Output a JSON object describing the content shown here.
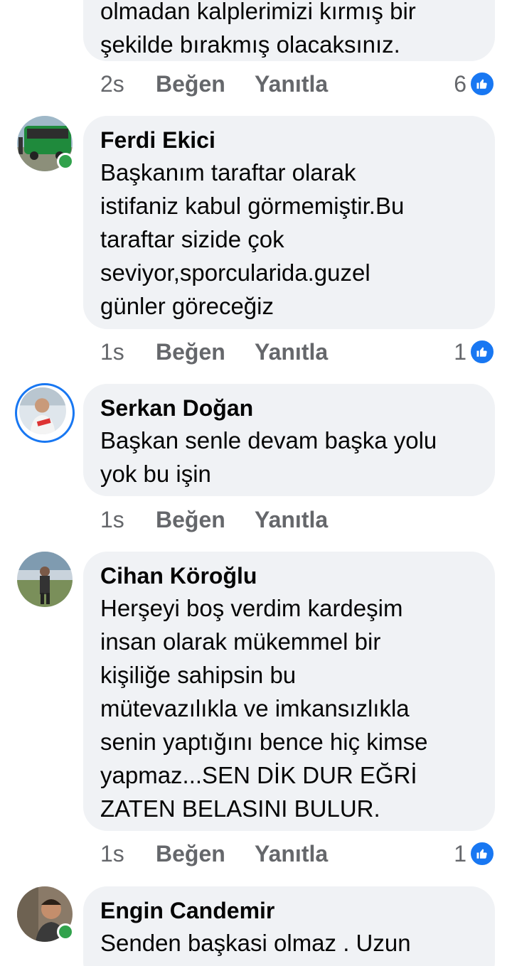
{
  "comments": [
    {
      "author": "",
      "text": "olmadan kalplerimizi kırmış bir\nşekilde bırakmış olacaksınız.",
      "time": "2s",
      "like_label": "Beğen",
      "reply_label": "Yanıtla",
      "like_count": "6"
    },
    {
      "author": "Ferdi Ekici",
      "text": "Başkanım taraftar olarak\nistifaniz kabul görmemiştir.Bu\ntaraftar sizide çok\nseviyor,sporcularida.guzel\ngünler göreceğiz",
      "time": "1s",
      "like_label": "Beğen",
      "reply_label": "Yanıtla",
      "like_count": "1"
    },
    {
      "author": "Serkan Doğan",
      "text": "Başkan senle devam başka yolu\nyok bu işin",
      "time": "1s",
      "like_label": "Beğen",
      "reply_label": "Yanıtla",
      "like_count": ""
    },
    {
      "author": "Cihan Köroğlu",
      "text": "Herşeyi boş verdim kardeşim\ninsan olarak mükemmel bir\nkişiliğe sahipsin bu\nmütevazılıkla ve imkansızlıkla\nsenin yaptığını bence hiç kimse\nyapmaz...SEN DİK DUR EĞRİ\nZATEN BELASINI BULUR.",
      "time": "1s",
      "like_label": "Beğen",
      "reply_label": "Yanıtla",
      "like_count": "1"
    },
    {
      "author": "Engin Candemir",
      "text": "Senden başkasi olmaz . Uzun",
      "time": "",
      "like_label": "",
      "reply_label": "",
      "like_count": ""
    }
  ],
  "colors": {
    "bubble": "#f0f2f5",
    "meta_text": "#65676b",
    "like_blue": "#1877f2",
    "online_green": "#31a24c"
  },
  "icons": {
    "like": "thumbs-up-icon",
    "online": "online-status-dot"
  }
}
